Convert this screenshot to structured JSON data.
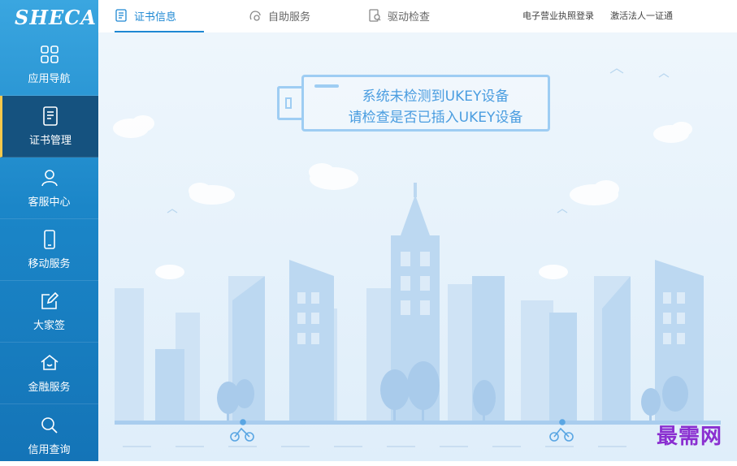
{
  "logo": {
    "text": "SHECA"
  },
  "sidebar": {
    "items": [
      {
        "label": "应用导航",
        "icon": "grid-icon"
      },
      {
        "label": "证书管理",
        "icon": "certificate-icon",
        "active": true
      },
      {
        "label": "客服中心",
        "icon": "user-icon"
      },
      {
        "label": "移动服务",
        "icon": "mobile-icon"
      },
      {
        "label": "大家签",
        "icon": "edit-icon"
      },
      {
        "label": "金融服务",
        "icon": "home-icon"
      },
      {
        "label": "信用查询",
        "icon": "search-icon"
      }
    ]
  },
  "tabs": [
    {
      "label": "证书信息",
      "icon": "document-icon",
      "active": true
    },
    {
      "label": "自助服务",
      "icon": "self-service-icon"
    },
    {
      "label": "驱动检查",
      "icon": "driver-check-icon"
    }
  ],
  "header_links": {
    "license_login": "电子营业执照登录",
    "activate": "激活法人一证通"
  },
  "message": {
    "line1": "系统未检测到UKEY设备",
    "line2": "请检查是否已插入UKEY设备"
  },
  "watermark": "最需网",
  "colors": {
    "sidebar_top": "#3aa6e0",
    "sidebar_bottom": "#1474b7",
    "sidebar_active": "#15527f",
    "active_indicator": "#f5c84c",
    "accent": "#1e88d3",
    "message_text": "#4a9de0",
    "watermark": "#8a2ed0"
  }
}
